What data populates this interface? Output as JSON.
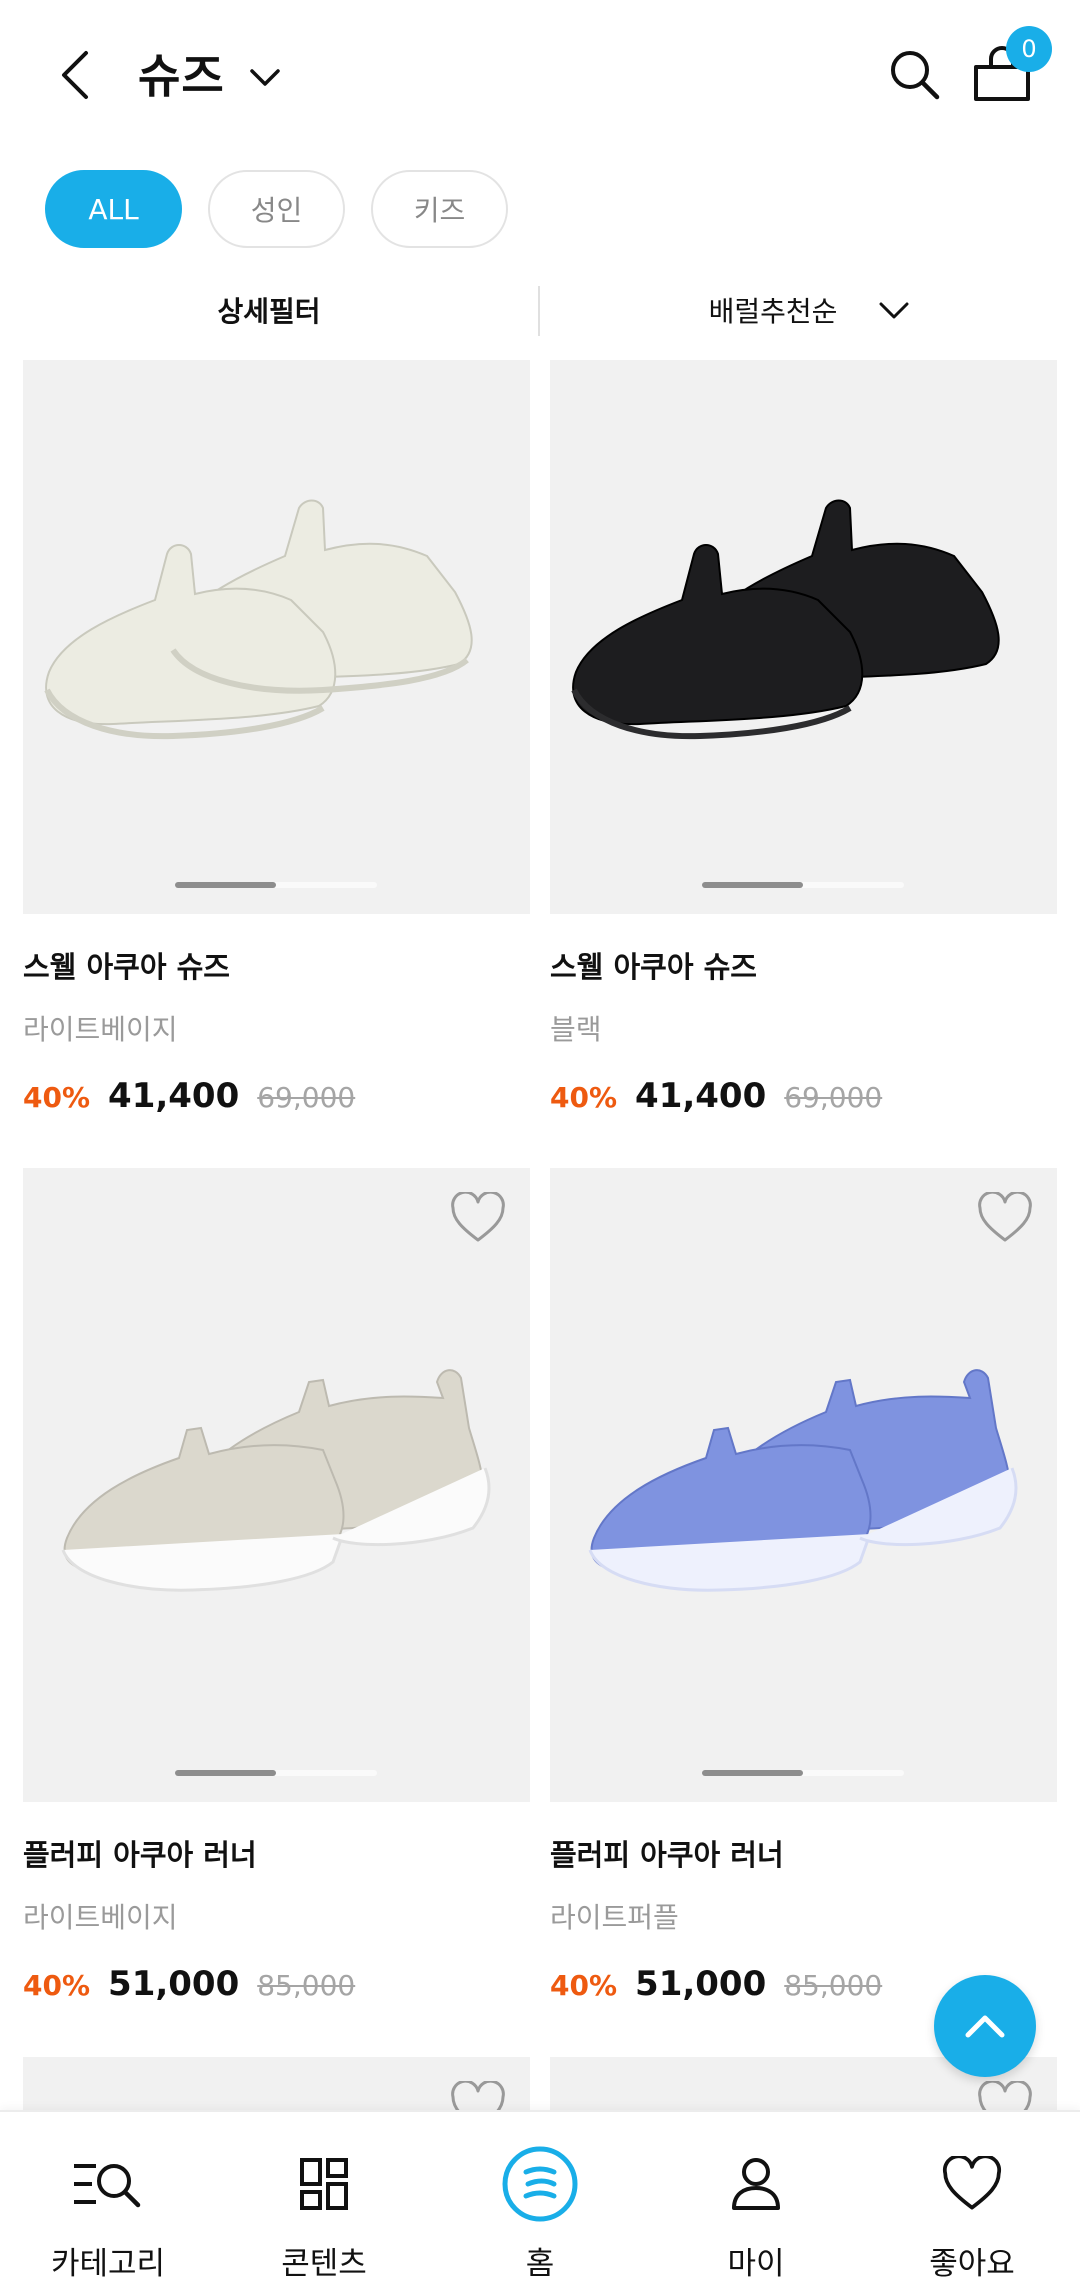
{
  "header": {
    "title": "슈즈",
    "cart_count": "0",
    "icons": {
      "back": "chevron-left-icon",
      "title_dropdown": "chevron-down-icon",
      "search": "search-icon",
      "cart": "shopping-bag-icon"
    }
  },
  "chips": [
    {
      "label": "ALL",
      "active": true
    },
    {
      "label": "성인",
      "active": false
    },
    {
      "label": "키즈",
      "active": false
    }
  ],
  "sortbar": {
    "detail_filter": "상세필터",
    "sort_label": "배럴추천순"
  },
  "products": [
    {
      "name": "스웰 아쿠아 슈즈",
      "color": "라이트베이지",
      "discount": "40%",
      "price": "41,400",
      "original_price": "69,000",
      "shoe_color": "#ecece2",
      "wishlist": false
    },
    {
      "name": "스웰 아쿠아 슈즈",
      "color": "블랙",
      "discount": "40%",
      "price": "41,400",
      "original_price": "69,000",
      "shoe_color": "#1d1d1f",
      "wishlist": false
    },
    {
      "name": "플러피 아쿠아 러너",
      "color": "라이트베이지",
      "discount": "40%",
      "price": "51,000",
      "original_price": "85,000",
      "shoe_color": "#dbd8cd",
      "wishlist": true
    },
    {
      "name": "플러피 아쿠아 러너",
      "color": "라이트퍼플",
      "discount": "40%",
      "price": "51,000",
      "original_price": "85,000",
      "shoe_color": "#7f93e0",
      "wishlist": true
    }
  ],
  "image_carousel_position": 0.5,
  "bottom_nav": [
    {
      "label": "카테고리",
      "icon": "category-search-icon"
    },
    {
      "label": "콘텐츠",
      "icon": "grid-icon"
    },
    {
      "label": "홈",
      "icon": "home-logo-icon"
    },
    {
      "label": "마이",
      "icon": "person-icon"
    },
    {
      "label": "좋아요",
      "icon": "heart-icon"
    }
  ],
  "colors": {
    "accent": "#19aee8",
    "discount": "#ee5a10",
    "image_bg": "#f1f1f1"
  }
}
